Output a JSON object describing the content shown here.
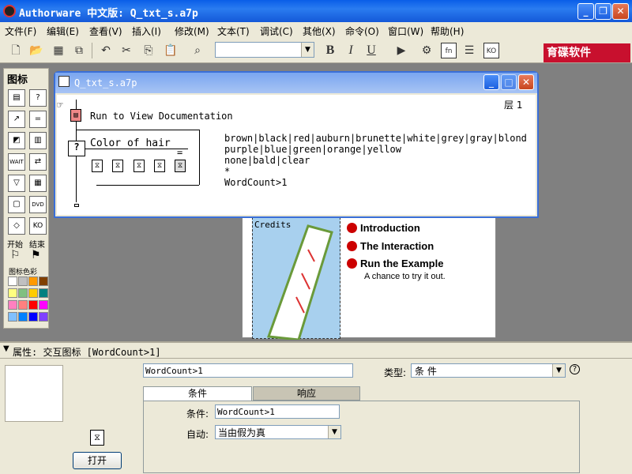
{
  "window": {
    "title": "Authorware 中文版: Q_txt_s.a7p"
  },
  "menu": [
    "文件(F)",
    "编辑(E)",
    "查看(V)",
    "插入(I)",
    "修改(M)",
    "文本(T)",
    "调试(C)",
    "其他(X)",
    "命令(O)",
    "窗口(W)",
    "帮助(H)"
  ],
  "toolbar": {
    "font_combo_value": "",
    "bold": "B",
    "italic": "I",
    "underline": "U",
    "brand": "育碟软件"
  },
  "palette": {
    "title": "图标",
    "start_label": "开始",
    "end_label": "结束",
    "color_label": "图标色彩",
    "colors": [
      "#ffffff",
      "#c0c0c0",
      "#ff9900",
      "#804000",
      "#ffff80",
      "#80c080",
      "#ffcc00",
      "#008080",
      "#ff80c0",
      "#ff8080",
      "#ff0000",
      "#ff00ff",
      "#80c0ff",
      "#0080ff",
      "#0000ff",
      "#8040ff"
    ]
  },
  "flowchart": {
    "title": "Q_txt_s.a7p",
    "level": "层 1",
    "doc_icon_label": "Run to View Documentation",
    "interaction_label": "Color of hair",
    "equals": "=",
    "conditions": [
      "brown|black|red|auburn|brunette|white|grey|gray|blond",
      "purple|blue|green|orange|yellow",
      "none|bald|clear",
      "*",
      "WordCount>1"
    ]
  },
  "stage": {
    "credits_label": "Credits",
    "nav": [
      "Introduction",
      "The Interaction",
      "Run the Example"
    ],
    "nav_sub": "A chance to try it out."
  },
  "properties": {
    "header": "属性: 交互图标 [WordCount>1]",
    "name_value": "WordCount>1",
    "type_label": "类型:",
    "type_value": "条   件",
    "help": "?",
    "tab_condition": "条件",
    "tab_response": "响应",
    "condition_label": "条件:",
    "condition_value": "WordCount>1",
    "auto_label": "自动:",
    "auto_value": "当由假为真",
    "open_button": "打开"
  }
}
